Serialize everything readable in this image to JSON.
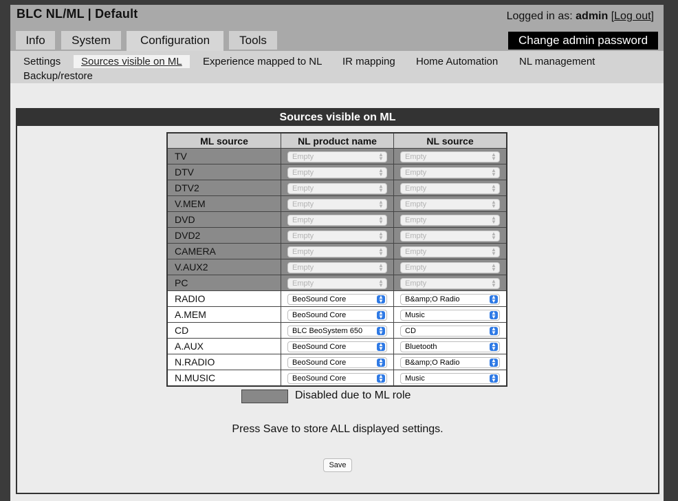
{
  "app": {
    "title": "BLC NL/ML | Default"
  },
  "login": {
    "prefix": "Logged in as:",
    "user": "admin",
    "logout": "Log out"
  },
  "tabs": [
    {
      "label": "Info"
    },
    {
      "label": "System"
    },
    {
      "label": "Configuration"
    },
    {
      "label": "Tools"
    }
  ],
  "change_password_label": "Change admin password",
  "subnav": [
    {
      "label": "Settings"
    },
    {
      "label": "Sources visible on ML"
    },
    {
      "label": "Experience mapped to NL"
    },
    {
      "label": "IR mapping"
    },
    {
      "label": "Home Automation"
    },
    {
      "label": "NL management"
    },
    {
      "label": "Backup/restore"
    }
  ],
  "panel": {
    "title": "Sources visible on ML",
    "columns": [
      "ML source",
      "NL product name",
      "NL source"
    ],
    "rows": [
      {
        "source": "TV",
        "product": "Empty",
        "nl_source": "Empty",
        "disabled": true
      },
      {
        "source": "DTV",
        "product": "Empty",
        "nl_source": "Empty",
        "disabled": true
      },
      {
        "source": "DTV2",
        "product": "Empty",
        "nl_source": "Empty",
        "disabled": true
      },
      {
        "source": "V.MEM",
        "product": "Empty",
        "nl_source": "Empty",
        "disabled": true
      },
      {
        "source": "DVD",
        "product": "Empty",
        "nl_source": "Empty",
        "disabled": true
      },
      {
        "source": "DVD2",
        "product": "Empty",
        "nl_source": "Empty",
        "disabled": true
      },
      {
        "source": "CAMERA",
        "product": "Empty",
        "nl_source": "Empty",
        "disabled": true
      },
      {
        "source": "V.AUX2",
        "product": "Empty",
        "nl_source": "Empty",
        "disabled": true
      },
      {
        "source": "PC",
        "product": "Empty",
        "nl_source": "Empty",
        "disabled": true
      },
      {
        "source": "RADIO",
        "product": "BeoSound Core",
        "nl_source": "B&amp;O Radio",
        "disabled": false
      },
      {
        "source": "A.MEM",
        "product": "BeoSound Core",
        "nl_source": "Music",
        "disabled": false
      },
      {
        "source": "CD",
        "product": "BLC BeoSystem 650",
        "nl_source": "CD",
        "disabled": false
      },
      {
        "source": "A.AUX",
        "product": "BeoSound Core",
        "nl_source": "Bluetooth",
        "disabled": false
      },
      {
        "source": "N.RADIO",
        "product": "BeoSound Core",
        "nl_source": "B&amp;O Radio",
        "disabled": false
      },
      {
        "source": "N.MUSIC",
        "product": "BeoSound Core",
        "nl_source": "Music",
        "disabled": false
      }
    ],
    "legend": "Disabled due to ML role",
    "note": "Press Save to store ALL displayed settings.",
    "save_label": "Save"
  },
  "colors": {
    "disabled_row": "#8a8a8a",
    "select_arrow": "#2f7ae5",
    "header_bar": "#333333"
  }
}
